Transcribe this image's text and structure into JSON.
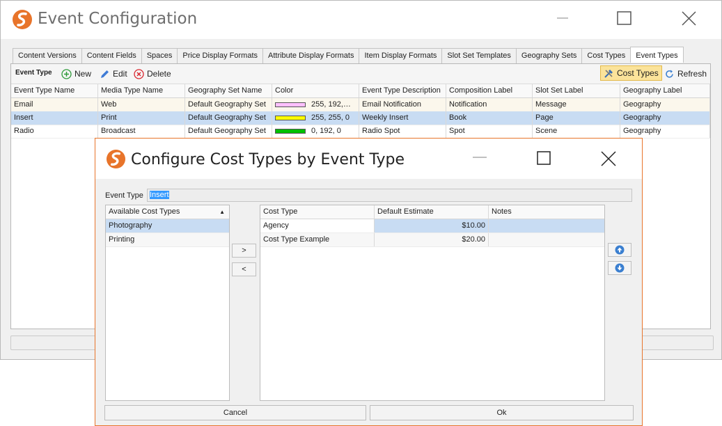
{
  "window": {
    "title": "Event Configuration",
    "controls": [
      "minimize-icon",
      "maximize-icon",
      "close-icon"
    ]
  },
  "tabs": [
    {
      "label": "Content Versions",
      "active": false
    },
    {
      "label": "Content Fields",
      "active": false
    },
    {
      "label": "Spaces",
      "active": false
    },
    {
      "label": "Price Display Formats",
      "active": false
    },
    {
      "label": "Attribute Display Formats",
      "active": false
    },
    {
      "label": "Item Display Formats",
      "active": false
    },
    {
      "label": "Slot Set Templates",
      "active": false
    },
    {
      "label": "Geography Sets",
      "active": false
    },
    {
      "label": "Cost Types",
      "active": false
    },
    {
      "label": "Event Types",
      "active": true
    }
  ],
  "toolbar": {
    "section_label": "Event Type",
    "new_label": "New",
    "edit_label": "Edit",
    "delete_label": "Delete",
    "cost_types_label": "Cost Types",
    "refresh_label": "Refresh"
  },
  "grid": {
    "columns": [
      "Event Type Name",
      "Media Type Name",
      "Geography Set Name",
      "Color",
      "Event Type Description",
      "Composition Label",
      "Slot Set Label",
      "Geography Label"
    ],
    "rows": [
      {
        "name": "Email",
        "media": "Web",
        "geoset": "Default Geography Set",
        "color_text": "255, 192,…",
        "color_hex": "#ffc0ff",
        "description": "Email Notification",
        "composition": "Notification",
        "slotset": "Message",
        "geography": "Geography"
      },
      {
        "name": "Insert",
        "media": "Print",
        "geoset": "Default Geography Set",
        "color_text": "255, 255, 0",
        "color_hex": "#ffff00",
        "description": "Weekly Insert",
        "composition": "Book",
        "slotset": "Page",
        "geography": "Geography"
      },
      {
        "name": "Radio",
        "media": "Broadcast",
        "geoset": "Default Geography Set",
        "color_text": "0, 192, 0",
        "color_hex": "#00c000",
        "description": "Radio Spot",
        "composition": "Spot",
        "slotset": "Scene",
        "geography": "Geography"
      }
    ]
  },
  "dialog": {
    "title": "Configure Cost Types by Event Type",
    "event_type_label": "Event Type",
    "event_type_value": "Insert",
    "available": {
      "header": "Available Cost Types",
      "items": [
        "Photography",
        "Printing"
      ]
    },
    "add_label": ">",
    "remove_label": "<",
    "assigned": {
      "columns": [
        "Cost Type",
        "Default Estimate",
        "Notes"
      ],
      "rows": [
        {
          "cost_type": "Agency",
          "estimate": "$10.00",
          "notes": ""
        },
        {
          "cost_type": "Cost Type Example",
          "estimate": "$20.00",
          "notes": ""
        }
      ]
    },
    "cancel_label": "Cancel",
    "ok_label": "Ok"
  },
  "colors": {
    "accent_border": "#e8742a",
    "selection": "#c8dcf3",
    "pressed_button": "#fbe39a"
  }
}
